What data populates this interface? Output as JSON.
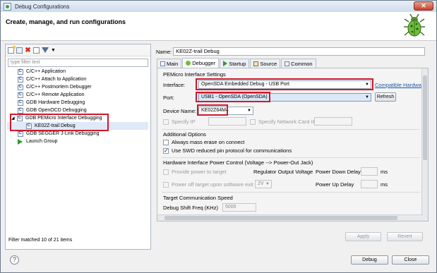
{
  "window": {
    "title": "Debug Configurations",
    "close_glyph": "✕"
  },
  "header": {
    "title": "Create, manage, and run configurations"
  },
  "left": {
    "filter_placeholder": "type filter text",
    "status": "Filter matched 10 of 21 items",
    "items": [
      {
        "label": "C/C++ Application",
        "icon": "c-config-icon"
      },
      {
        "label": "C/C++ Attach to Application",
        "icon": "c-config-icon"
      },
      {
        "label": "C/C++ Postmortem Debugger",
        "icon": "c-config-icon"
      },
      {
        "label": "C/C++ Remote Application",
        "icon": "c-config-icon"
      },
      {
        "label": "GDB Hardware Debugging",
        "icon": "c-config-icon"
      },
      {
        "label": "GDB OpenOCD Debugging",
        "icon": "c-config-icon"
      },
      {
        "label": "GDB PEMicro Interface Debugging",
        "icon": "c-config-icon",
        "expanded": true
      },
      {
        "label": "KE02Z-trail Debug",
        "icon": "c-config-icon",
        "selected": true
      },
      {
        "label": "GDB SEGGER J-Link Debugging",
        "icon": "c-config-icon"
      },
      {
        "label": "Launch Group",
        "icon": "launch-group-icon"
      }
    ],
    "twisty": "◢"
  },
  "right": {
    "name_label": "Name:",
    "name_value": "KE02Z-trail Debug",
    "tabs": [
      {
        "label": "Main",
        "active": false
      },
      {
        "label": "Debugger",
        "active": true
      },
      {
        "label": "Startup",
        "active": false
      },
      {
        "label": "Source",
        "active": false
      },
      {
        "label": "Common",
        "active": false
      }
    ],
    "pemicro_title": "PEMicro Interface Settings",
    "interface_label": "Interface:",
    "interface_value": "OpenSDA Embedded Debug - USB Port",
    "compatible_link": "Compatible Hardwa",
    "port_label": "Port:",
    "port_value": "USB1 - OpenSDA (OpenSDA)",
    "refresh": "Refresh",
    "device_label": "Device Name:",
    "device_value": "KE02Z64M4",
    "specify_ip": "Specify IP",
    "specify_network": "Specify Network Card IP",
    "additional_title": "Additional Options",
    "mass_erase": "Always mass erase on connect",
    "swd": "Use SWD reduced pin protocol for communications",
    "power_title": "Hardware Interface Power Control (Voltage --> Power-Out Jack)",
    "provide_power": "Provide power to target",
    "regulator": "Regulator Output Voltage",
    "power_down": "Power Down Delay",
    "ms1": "ms",
    "power_off": "Power off target upon software exit",
    "voltage_value": "2V",
    "power_up": "Power Up Delay",
    "ms2": "ms",
    "comm_title": "Target Communication Speed",
    "shift_label": "Debug Shift Freq (KHz)",
    "shift_value": "5000",
    "apply": "Apply",
    "revert": "Revert"
  },
  "footer": {
    "help": "?",
    "debug": "Debug",
    "close": "Close"
  },
  "colors": {
    "highlight_box": "#d0182b",
    "link": "#1a5aa6"
  },
  "combo_arrow": "▼"
}
